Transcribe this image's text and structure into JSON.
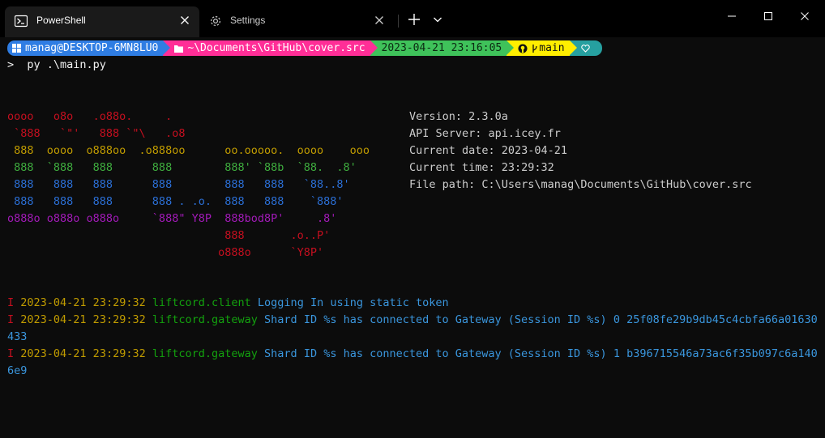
{
  "tabs": [
    {
      "title": "PowerShell",
      "icon": "powershell-icon",
      "active": true
    },
    {
      "title": "Settings",
      "icon": "gear-icon",
      "active": false
    }
  ],
  "prompt": {
    "user": "manag@DESKTOP-6MN8LU0",
    "path": "~\\Documents\\GitHub\\cover.src",
    "time": "2023-04-21 23:16:05",
    "branch": "main",
    "command": ">  py .\\main.py"
  },
  "banner": {
    "lines": [
      {
        "text": "oooo   o8o   .o88o.     .",
        "color": "red"
      },
      {
        "text": " `888   `\"'   888 `\"\\   .o8",
        "color": "red"
      },
      {
        "text": " 888  oooo  o888oo  .o888oo      oo.ooooo.  oooo    ooo",
        "color": "orange"
      },
      {
        "text": " 888  `888   888      888        888' `88b  `88.  .8'",
        "color": "green"
      },
      {
        "text": " 888   888   888      888        888   888   `88..8'",
        "color": "blue"
      },
      {
        "text": " 888   888   888      888 . .o.  888   888    `888'",
        "color": "blue"
      },
      {
        "text": "o888o o888o o888o     `888\" Y8P  888bod8P'     .8'",
        "color": "purple"
      },
      {
        "text": "                                 888       .o..P'",
        "color": "red"
      },
      {
        "text": "                                o888o      `Y8P'",
        "color": "red"
      }
    ]
  },
  "info": [
    "Version: 2.3.0a",
    "API Server: api.icey.fr",
    "Current date: 2023-04-21",
    "Current time: 23:29:32",
    "File path: C:\\Users\\manag\\Documents\\GitHub\\cover.src"
  ],
  "logs": [
    {
      "level": "I",
      "timestamp": "2023-04-21 23:29:32",
      "logger": "liftcord.client",
      "message": "Logging In using static token",
      "cont": ""
    },
    {
      "level": "I",
      "timestamp": "2023-04-21 23:29:32",
      "logger": "liftcord.gateway",
      "message": "Shard ID %s has connected to Gateway (Session ID %s) 0 25f08fe29b9db45c4cbfa66a01630",
      "cont": "433"
    },
    {
      "level": "I",
      "timestamp": "2023-04-21 23:29:32",
      "logger": "liftcord.gateway",
      "message": "Shard ID %s has connected to Gateway (Session ID %s) 1 b396715546a73ac6f35b097c6a140",
      "cont": "6e9"
    }
  ],
  "colors": {
    "background": "#0c0c0c",
    "prompt_user": "#2f7de3",
    "prompt_path": "#ff2e97",
    "prompt_time": "#3fc25a",
    "prompt_git": "#ffee00",
    "prompt_end": "#26a0a0"
  }
}
